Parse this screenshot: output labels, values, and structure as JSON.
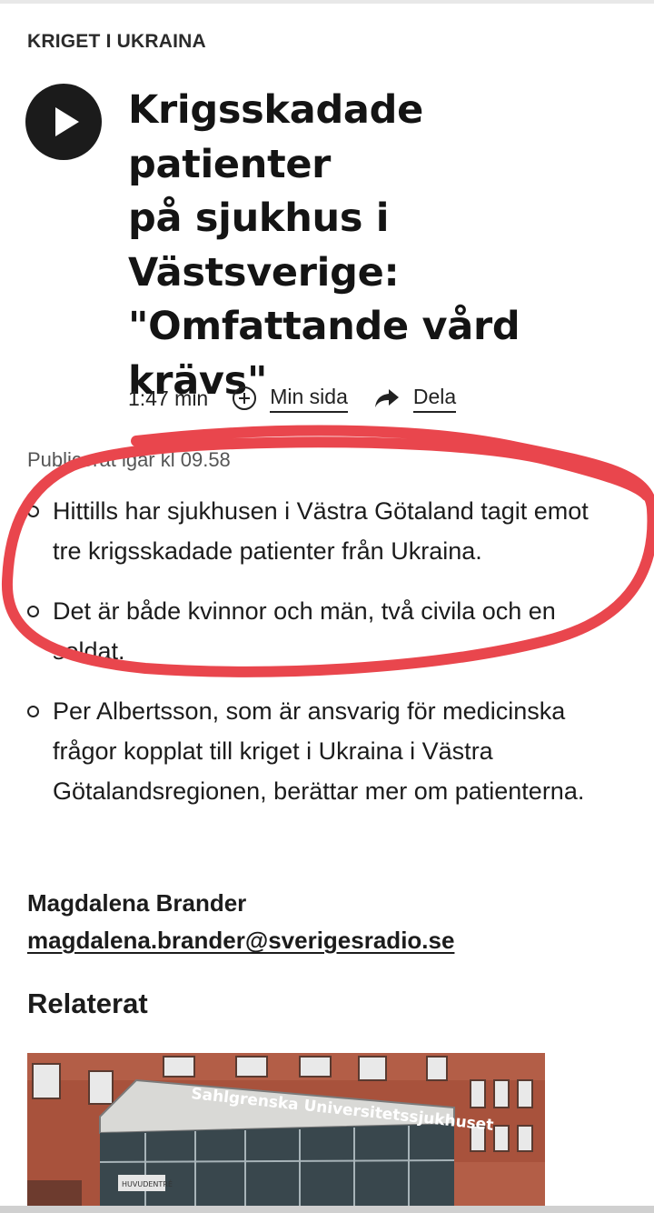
{
  "article": {
    "kicker": "KRIGET I UKRAINA",
    "title_lines": [
      "Krigsskadade patienter",
      "på sjukhus i",
      "Västsverige:",
      "\"Omfattande vård",
      "krävs\""
    ],
    "duration": "1:47 min",
    "my_page_label": "Min sida",
    "share_label": "Dela",
    "published": "Publicerat igår kl 09.58",
    "bullets": [
      "Hittills har sjukhusen i Västra Götaland tagit emot tre krigsskadade patienter från Ukraina.",
      "Det är både kvinnor och män, två civila och en soldat.",
      "Per Albertsson, som är ansvarig för medicinska frågor kopplat till kriget i Ukraina i Västra Götalandsregionen, berättar mer om patienterna."
    ],
    "author_name": "Magdalena Brander",
    "author_email": "magdalena.brander@sverigesradio.se"
  },
  "related": {
    "heading": "Relaterat",
    "image_sign_text": "Sahlgrenska Universitetssjukhuset",
    "image_door_sign": "HUVUDENTRÉ"
  },
  "colors": {
    "annotation_red": "#e9464d",
    "play_button": "#1b1b1b",
    "text": "#1a1a1a"
  },
  "icons": {
    "play": "play-icon",
    "add": "plus-circle-icon",
    "share": "share-arrow-icon"
  }
}
